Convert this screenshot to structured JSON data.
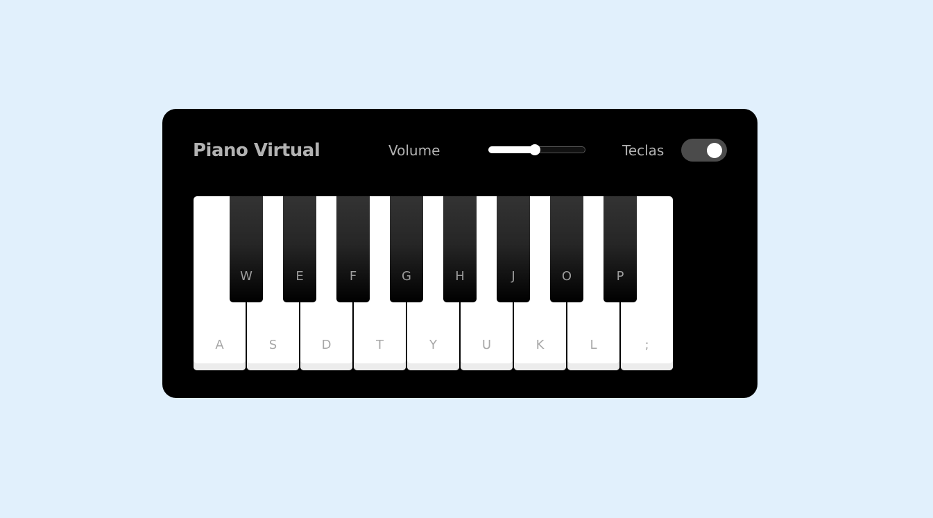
{
  "app": {
    "title": "Piano Virtual"
  },
  "controls": {
    "volume_label": "Volume",
    "volume_value": 0.48,
    "keys_label": "Teclas",
    "keys_toggle_on": true
  },
  "piano": {
    "white_keys": [
      "A",
      "S",
      "D",
      "T",
      "Y",
      "U",
      "K",
      "L",
      ";"
    ],
    "black_keys": [
      "W",
      "E",
      "F",
      "G",
      "H",
      "J",
      "O",
      "P"
    ]
  },
  "colors": {
    "page_background": "#e1f0fc",
    "panel_background": "#000000",
    "text_muted": "#b2b2b2",
    "toggle_track": "#4b4b4b"
  }
}
